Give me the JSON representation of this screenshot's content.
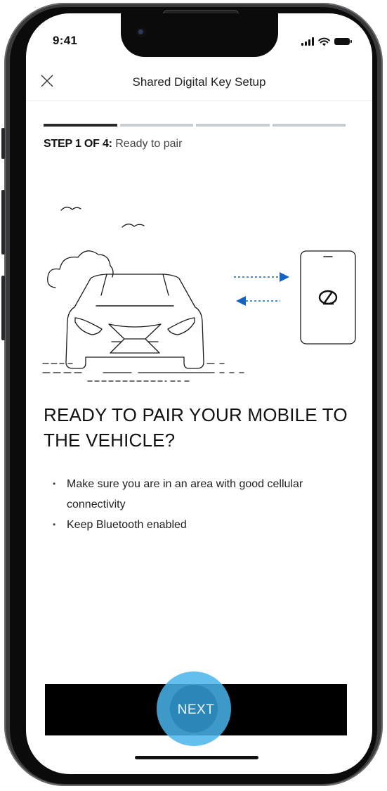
{
  "status_bar": {
    "time": "9:41"
  },
  "header": {
    "title": "Shared Digital Key Setup",
    "close_icon": "close-icon"
  },
  "progress": {
    "step_prefix": "STEP 1 OF 4:",
    "step_name": "Ready to pair",
    "current_step": 1,
    "total_steps": 4
  },
  "main": {
    "headline": "READY TO PAIR YOUR MOBILE TO THE VEHICLE?",
    "bullets": [
      "Make sure you are in an area with good cellular connectivity",
      "Keep Bluetooth enabled"
    ]
  },
  "footer": {
    "next_label": "NEXT"
  },
  "colors": {
    "accent_blue": "#1565c0",
    "button_bg": "#000000",
    "tap_highlight": "#46b4eb"
  }
}
